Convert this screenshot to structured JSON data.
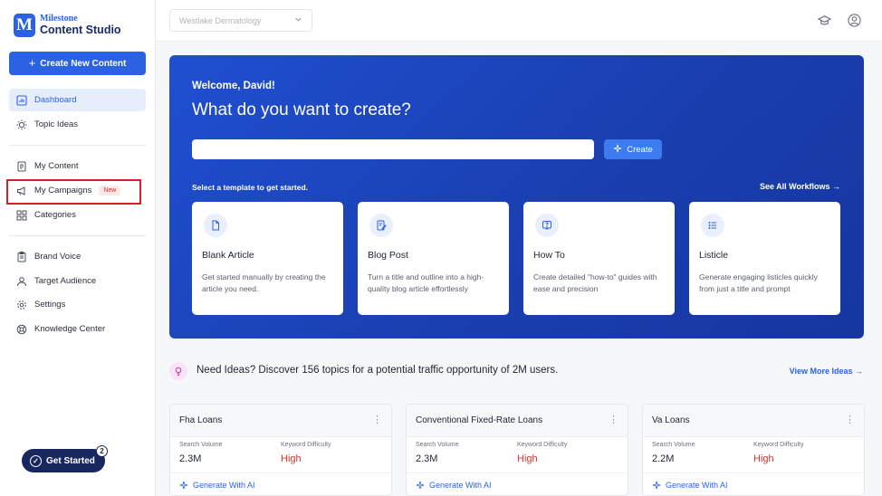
{
  "brand": {
    "top": "Milestone",
    "bottom": "Content Studio",
    "mark": "M"
  },
  "sidebar": {
    "create_button": "Create New Content",
    "items": [
      {
        "label": "Dashboard",
        "icon": "dashboard-icon",
        "active": true
      },
      {
        "label": "Topic Ideas",
        "icon": "lightbulb-icon"
      },
      {
        "label": "My Content",
        "icon": "document-icon"
      },
      {
        "label": "My Campaigns",
        "icon": "megaphone-icon",
        "badge": "New"
      },
      {
        "label": "Categories",
        "icon": "grid-icon"
      },
      {
        "label": "Brand Voice",
        "icon": "clipboard-icon"
      },
      {
        "label": "Target Audience",
        "icon": "users-icon"
      },
      {
        "label": "Settings",
        "icon": "gear-icon"
      },
      {
        "label": "Knowledge Center",
        "icon": "help-circle-icon"
      }
    ],
    "get_started": {
      "label": "Get Started",
      "count": "2"
    }
  },
  "topbar": {
    "location": "Westlake Dermatology",
    "icons": [
      "graduation-cap-icon",
      "user-icon"
    ]
  },
  "hero": {
    "welcome": "Welcome, David!",
    "title": "What do you want to create?",
    "input_value": "",
    "create_button": "Create",
    "template_prompt": "Select a template to get started.",
    "see_all": "See All Workflows",
    "templates": [
      {
        "title": "Blank Article",
        "description": "Get started manually by creating the article you need.",
        "icon": "file-icon"
      },
      {
        "title": "Blog Post",
        "description": "Turn a title and outline into a high-quality blog article effortlessly",
        "icon": "edit-document-icon"
      },
      {
        "title": "How To",
        "description": "Create detailed \"how-to\" guides with ease and precision",
        "icon": "question-bubble-icon"
      },
      {
        "title": "Listicle",
        "description": "Generate engaging listicles quickly from just a title and prompt",
        "icon": "list-icon"
      }
    ]
  },
  "ideas": {
    "headline": "Need Ideas? Discover 156 topics for a potential traffic opportunity of 2M users.",
    "view_more": "View More Ideas",
    "cards": [
      {
        "title": "Fha Loans",
        "volume_label": "Search Volume",
        "volume": "2.3M",
        "difficulty_label": "Keyword Difficulty",
        "difficulty": "High",
        "action": "Generate With AI"
      },
      {
        "title": "Conventional Fixed-Rate Loans",
        "volume_label": "Search Volume",
        "volume": "2.3M",
        "difficulty_label": "Keyword Difficulty",
        "difficulty": "High",
        "action": "Generate With AI"
      },
      {
        "title": "Va Loans",
        "volume_label": "Search Volume",
        "volume": "2.2M",
        "difficulty_label": "Keyword Difficulty",
        "difficulty": "High",
        "action": "Generate With AI"
      }
    ]
  },
  "colors": {
    "accent": "#2b62e3",
    "hero": "#1f4fd1",
    "danger": "#d9342b",
    "highlight_box": "#d8202a"
  }
}
